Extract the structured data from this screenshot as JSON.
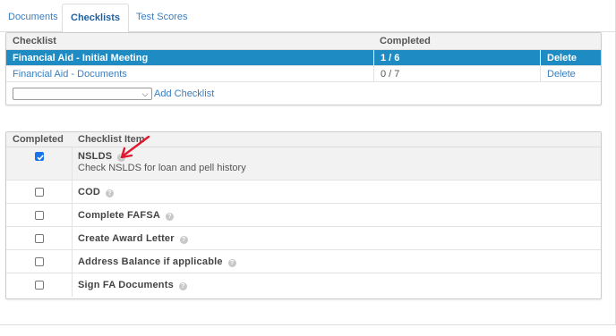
{
  "tabs": [
    {
      "label": "Documents"
    },
    {
      "label": "Checklists"
    },
    {
      "label": "Test Scores"
    }
  ],
  "checklists": {
    "columns": {
      "checklist": "Checklist",
      "completed": "Completed"
    },
    "rows": [
      {
        "name": "Financial Aid - Initial Meeting",
        "completed": "1 / 6",
        "action": "Delete"
      },
      {
        "name": "Financial Aid - Documents",
        "completed": "0 / 7",
        "action": "Delete"
      }
    ],
    "select_value": "",
    "add_label": "Add Checklist"
  },
  "items": {
    "columns": {
      "completed": "Completed",
      "item": "Checklist Item"
    },
    "rows": [
      {
        "label": "NSLDS",
        "description": "Check NSLDS for loan and pell history",
        "checked": true
      },
      {
        "label": "COD",
        "description": "",
        "checked": false
      },
      {
        "label": "Complete FAFSA",
        "description": "",
        "checked": false
      },
      {
        "label": "Create Award Letter",
        "description": "",
        "checked": false
      },
      {
        "label": "Address Balance if applicable",
        "description": "",
        "checked": false
      },
      {
        "label": "Sign FA Documents",
        "description": "",
        "checked": false
      }
    ],
    "help_glyph": "?"
  },
  "colors": {
    "selected_row": "#1e8bc3",
    "link": "#3a7ebf",
    "annotation_arrow": "#e0192f"
  },
  "icons": {
    "help": "question-circle-icon",
    "dropdown": "chevron-down-icon",
    "check": "checkmark-icon"
  }
}
